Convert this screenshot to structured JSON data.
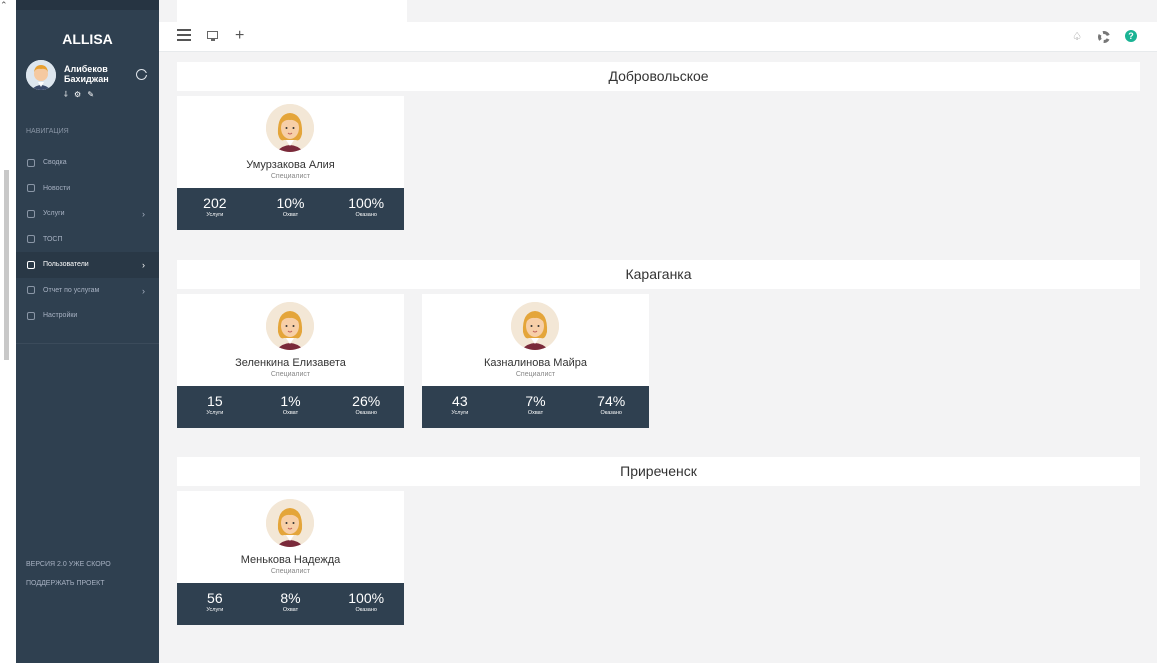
{
  "app": {
    "brand": "ALLISA"
  },
  "profile": {
    "name": "Алибеков Бахиджан",
    "mini_icons": "⸸ ⚙ ✎"
  },
  "nav": {
    "label": "НАВИГАЦИЯ",
    "items": [
      {
        "label": "Сводка",
        "icon": "dashboard-icon",
        "has_children": false,
        "active": false
      },
      {
        "label": "Новости",
        "icon": "news-icon",
        "has_children": false,
        "active": false
      },
      {
        "label": "Услуги",
        "icon": "services-icon",
        "has_children": true,
        "active": false
      },
      {
        "label": "ТОСП",
        "icon": "building-icon",
        "has_children": false,
        "active": false
      },
      {
        "label": "Пользователи",
        "icon": "users-icon",
        "has_children": true,
        "active": true
      },
      {
        "label": "Отчет по услугам",
        "icon": "report-icon",
        "has_children": true,
        "active": false
      },
      {
        "label": "Настройки",
        "icon": "gear-icon",
        "has_children": false,
        "active": false
      }
    ],
    "chevron": "›"
  },
  "footer": {
    "version": "ВЕРСИЯ 2.0 УЖЕ СКОРО",
    "support": "ПОДДЕРЖАТЬ ПРОЕКТ"
  },
  "topbar": {
    "plus": "+",
    "bell": "♤",
    "help": "?"
  },
  "stat_labels": {
    "services": "Услуги",
    "coverage": "Охват",
    "rendered": "Оказано"
  },
  "groups": [
    {
      "title": "Добровольское",
      "users": [
        {
          "name": "Умурзакова Алия",
          "role": "Специалист",
          "services": "202",
          "coverage": "10%",
          "rendered": "100%"
        }
      ]
    },
    {
      "title": "Караганка",
      "users": [
        {
          "name": "Зеленкина Елизавета",
          "role": "Специалист",
          "services": "15",
          "coverage": "1%",
          "rendered": "26%"
        },
        {
          "name": "Казналинова Майра",
          "role": "Специалист",
          "services": "43",
          "coverage": "7%",
          "rendered": "74%"
        }
      ]
    },
    {
      "title": "Приреченск",
      "users": [
        {
          "name": "Менькова Надежда",
          "role": "Специалист",
          "services": "56",
          "coverage": "8%",
          "rendered": "100%"
        }
      ]
    }
  ],
  "colors": {
    "sidebar": "#2f4050",
    "accent": "#1ab394",
    "stats_bg": "#2f4050"
  }
}
